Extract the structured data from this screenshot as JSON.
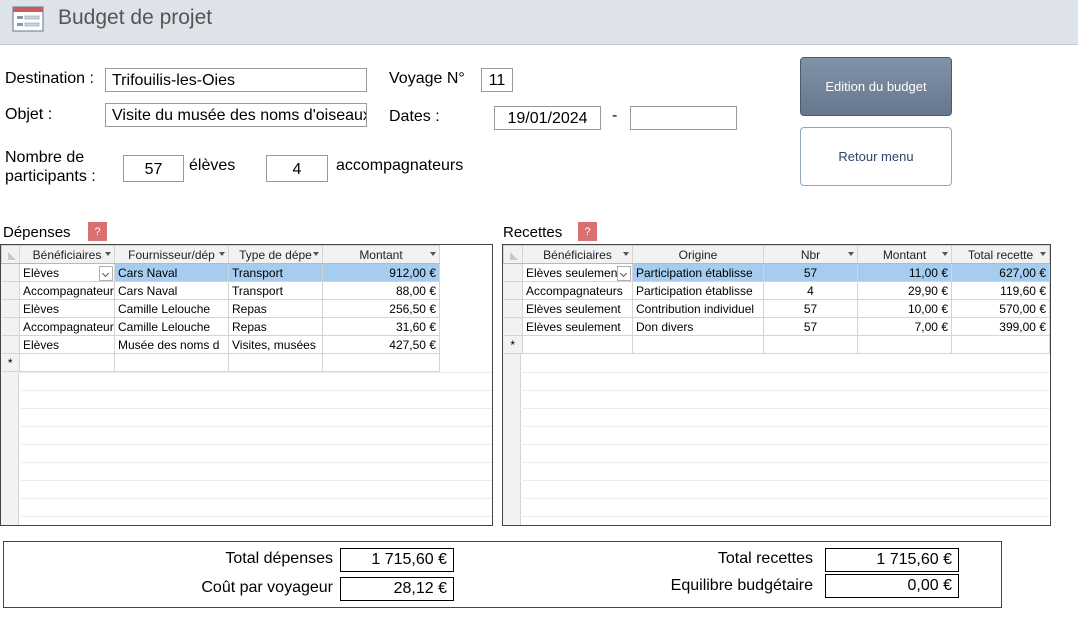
{
  "window": {
    "title": "Budget de projet"
  },
  "form": {
    "destination_label": "Destination :",
    "destination_value": "Trifouilis-les-Oies",
    "objet_label": "Objet :",
    "objet_value": "Visite du musée des noms d'oiseaux",
    "voyage_label": "Voyage N°",
    "voyage_value": "11",
    "dates_label": "Dates :",
    "date_start": "19/01/2024",
    "date_sep": "-",
    "date_end": "",
    "participants_label_1": "Nombre de",
    "participants_label_2": "participants :",
    "eleves_value": "57",
    "eleves_label": "élèves",
    "accomp_value": "4",
    "accomp_label": "accompagnateurs"
  },
  "buttons": {
    "edition": "Edition du budget",
    "retour": "Retour menu"
  },
  "help_glyph": "?",
  "new_row_glyph": "*",
  "depenses": {
    "title": "Dépenses",
    "columns": [
      "Bénéficiaires",
      "Fournisseur/dép",
      "Type de dépe",
      "Montant"
    ],
    "rows": [
      [
        "Elèves",
        "Cars Naval",
        "Transport",
        "912,00 €"
      ],
      [
        "Accompagnateur",
        "Cars Naval",
        "Transport",
        "88,00 €"
      ],
      [
        "Elèves",
        "Camille Lelouche",
        "Repas",
        "256,50 €"
      ],
      [
        "Accompagnateur",
        "Camille Lelouche",
        "Repas",
        "31,60 €"
      ],
      [
        "Elèves",
        "Musée des noms d",
        "Visites, musées",
        "427,50 €"
      ]
    ]
  },
  "recettes": {
    "title": "Recettes",
    "columns": [
      "Bénéficiaires",
      "Origine",
      "Nbr",
      "Montant",
      "Total recette"
    ],
    "rows": [
      [
        "Elèves seulement",
        "Participation établisse",
        "57",
        "11,00 €",
        "627,00 €"
      ],
      [
        "Accompagnateurs",
        "Participation établisse",
        "4",
        "29,90 €",
        "119,60 €"
      ],
      [
        "Elèves seulement",
        "Contribution individuel",
        "57",
        "10,00 €",
        "570,00 €"
      ],
      [
        "Elèves seulement",
        "Don divers",
        "57",
        "7,00 €",
        "399,00 €"
      ]
    ]
  },
  "totals": {
    "total_depenses_label": "Total dépenses",
    "total_depenses_value": "1 715,60 €",
    "cout_label": "Coût par voyageur",
    "cout_value": "28,12 €",
    "total_recettes_label": "Total recettes",
    "total_recettes_value": "1 715,60 €",
    "equilibre_label": "Equilibre budgétaire",
    "equilibre_value": "0,00 €"
  },
  "colors": {
    "titlebar": "#dee3ea",
    "selection": "#a6cdf0",
    "help_button": "#d9706f",
    "edition_button": "#74849a"
  },
  "icons": {
    "form_icon": "form-icon",
    "dropdown": "chevron-down-icon"
  }
}
